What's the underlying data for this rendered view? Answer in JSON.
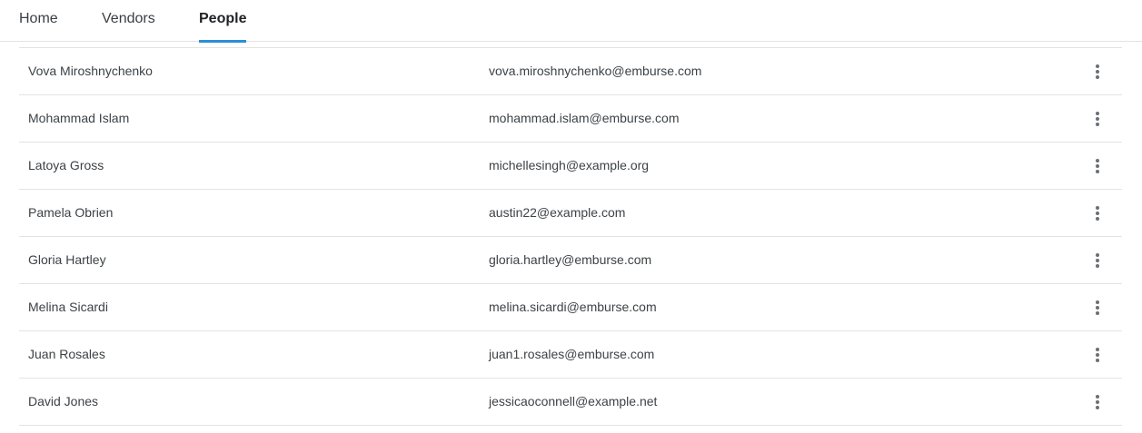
{
  "tabs": [
    {
      "label": "Home",
      "active": false
    },
    {
      "label": "Vendors",
      "active": false
    },
    {
      "label": "People",
      "active": true
    }
  ],
  "people": [
    {
      "name": "Vova Miroshnychenko",
      "email": "vova.miroshnychenko@emburse.com"
    },
    {
      "name": "Mohammad Islam",
      "email": "mohammad.islam@emburse.com"
    },
    {
      "name": "Latoya Gross",
      "email": "michellesingh@example.org"
    },
    {
      "name": "Pamela Obrien",
      "email": "austin22@example.com"
    },
    {
      "name": "Gloria Hartley",
      "email": "gloria.hartley@emburse.com"
    },
    {
      "name": "Melina Sicardi",
      "email": "melina.sicardi@emburse.com"
    },
    {
      "name": "Juan Rosales",
      "email": "juan1.rosales@emburse.com"
    },
    {
      "name": "David Jones",
      "email": "jessicaoconnell@example.net"
    }
  ],
  "icons": {
    "row_action": "more-vertical-icon"
  },
  "colors": {
    "accent": "#2a8fd6",
    "divider": "#e3e3e3",
    "text": "#3d4246"
  }
}
